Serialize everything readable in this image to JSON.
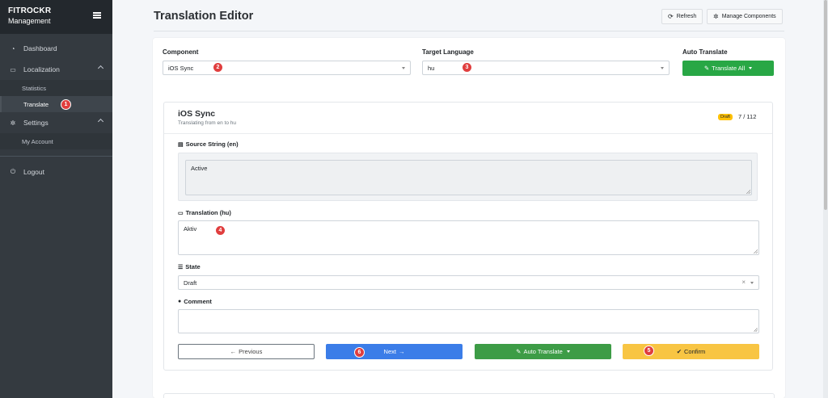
{
  "brand": {
    "title": "FITROCKR",
    "subtitle": "Management"
  },
  "sidebar": {
    "dashboard": "Dashboard",
    "localization": "Localization",
    "statistics": "Statistics",
    "translate": "Translate",
    "settings": "Settings",
    "my_account": "My Account",
    "logout": "Logout"
  },
  "header": {
    "title": "Translation Editor",
    "refresh": "Refresh",
    "manage": "Manage Components"
  },
  "filters": {
    "component_label": "Component",
    "component_value": "iOS Sync",
    "language_label": "Target Language",
    "language_value": "hu",
    "auto_label": "Auto Translate",
    "translate_all": "Translate All"
  },
  "editor": {
    "component_title": "iOS Sync",
    "subtitle": "Translating from en to hu",
    "badge": "Draft",
    "progress": "7 / 112",
    "source_label": "Source String (en)",
    "source_text": "Active",
    "translation_label": "Translation (hu)",
    "translation_text": "Aktiv",
    "state_label": "State",
    "state_value": "Draft",
    "comment_label": "Comment",
    "comment_text": ""
  },
  "actions": {
    "previous": "Previous",
    "next": "Next",
    "auto_translate": "Auto Translate",
    "confirm": "Confirm"
  },
  "markers": [
    "1",
    "2",
    "3",
    "4",
    "5",
    "6"
  ],
  "colors": {
    "sidebar": "#343a40",
    "green": "#28a745",
    "blue": "#3b7de8",
    "yellow": "#f8c543",
    "marker": "#e03e3e"
  }
}
